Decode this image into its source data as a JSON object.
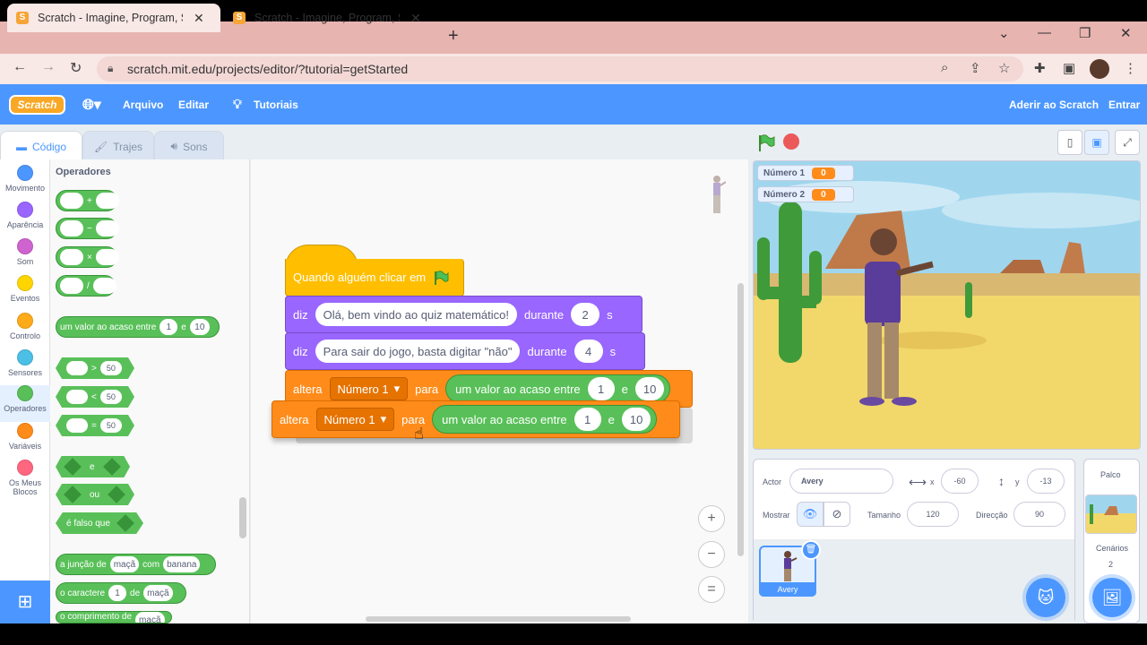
{
  "browser": {
    "tabs": [
      {
        "title": "Scratch - Imagine, Program, Share",
        "close": "✕"
      },
      {
        "title": "Scratch - Imagine, Program, Share",
        "close": "✕"
      }
    ],
    "new_tab": "+",
    "url": "scratch.mit.edu/projects/editor/?tutorial=getStarted",
    "window_controls": {
      "dropdown": "⌄",
      "minimize": "—",
      "restore": "❐",
      "close": "✕"
    }
  },
  "menubar": {
    "logo": "Scratch",
    "file": "Arquivo",
    "edit": "Editar",
    "tutorials": "Tutoriais",
    "join": "Aderir ao Scratch",
    "signin": "Entrar"
  },
  "editor_tabs": {
    "code": "Código",
    "costumes": "Trajes",
    "sounds": "Sons"
  },
  "categories": [
    {
      "label": "Movimento",
      "color": "#4c97ff"
    },
    {
      "label": "Aparência",
      "color": "#9966ff"
    },
    {
      "label": "Som",
      "color": "#cf63cf"
    },
    {
      "label": "Eventos",
      "color": "#ffd500"
    },
    {
      "label": "Controlo",
      "color": "#ffab19"
    },
    {
      "label": "Sensores",
      "color": "#4cbfe6"
    },
    {
      "label": "Operadores",
      "color": "#59c059"
    },
    {
      "label": "Variáveis",
      "color": "#ff8c1a"
    },
    {
      "label": "Os Meus Blocos",
      "color": "#ff6680"
    }
  ],
  "palette": {
    "title": "Operadores",
    "add": "+",
    "sub": "−",
    "mul": "×",
    "div": "/",
    "random_label": "um valor ao acaso entre",
    "random_from": "1",
    "random_and": "e",
    "random_to": "10",
    "gt": ">",
    "lt": "<",
    "eq": "=",
    "cmp_val": "50",
    "and": "e",
    "or": "ou",
    "not": "é falso que",
    "join_label": "a junção de",
    "join_a": "maçã",
    "join_with": "com",
    "join_b": "banana",
    "letter_label": "o caractere",
    "letter_idx": "1",
    "letter_of": "de",
    "letter_word": "maçã",
    "length_label": "o comprimento de",
    "length_word": "maçã"
  },
  "script": {
    "hat": "Quando alguém clicar em",
    "say1": {
      "verb": "diz",
      "msg": "Olá, bem vindo ao quiz matemático!",
      "dur_label": "durante",
      "secs": "2",
      "unit": "s"
    },
    "say2": {
      "verb": "diz",
      "msg": "Para sair do jogo, basta digitar \"não\"",
      "dur_label": "durante",
      "secs": "4",
      "unit": "s"
    },
    "set1": {
      "verb": "altera",
      "var": "Número 1",
      "to": "para",
      "op": "um valor ao acaso entre",
      "a": "1",
      "e": "e",
      "b": "10"
    },
    "set2": {
      "verb": "altera",
      "var": "Número 1",
      "to": "para",
      "op": "um valor ao acaso entre",
      "a": "1",
      "e": "e",
      "b": "10"
    }
  },
  "zoom": {
    "in": "+",
    "out": "−",
    "reset": "="
  },
  "stage": {
    "monitors": [
      {
        "label": "Número 1",
        "value": "0"
      },
      {
        "label": "Número 2",
        "value": "0"
      }
    ]
  },
  "sprite_info": {
    "actor_label": "Actor",
    "actor_name": "Avery",
    "x_label": "x",
    "x": "-60",
    "y_label": "y",
    "y": "-13",
    "show_label": "Mostrar",
    "size_label": "Tamanho",
    "size": "120",
    "direction_label": "Direcção",
    "direction": "90"
  },
  "sprites": [
    {
      "name": "Avery"
    }
  ],
  "stage_panel": {
    "title": "Palco",
    "backdrops_label": "Cenários",
    "backdrops_count": "2"
  },
  "colors": {
    "menubar": "#4c97ff",
    "looks": "#9966ff",
    "events": "#ffbf00",
    "variables": "#ff8c1a",
    "operators": "#59c059"
  }
}
